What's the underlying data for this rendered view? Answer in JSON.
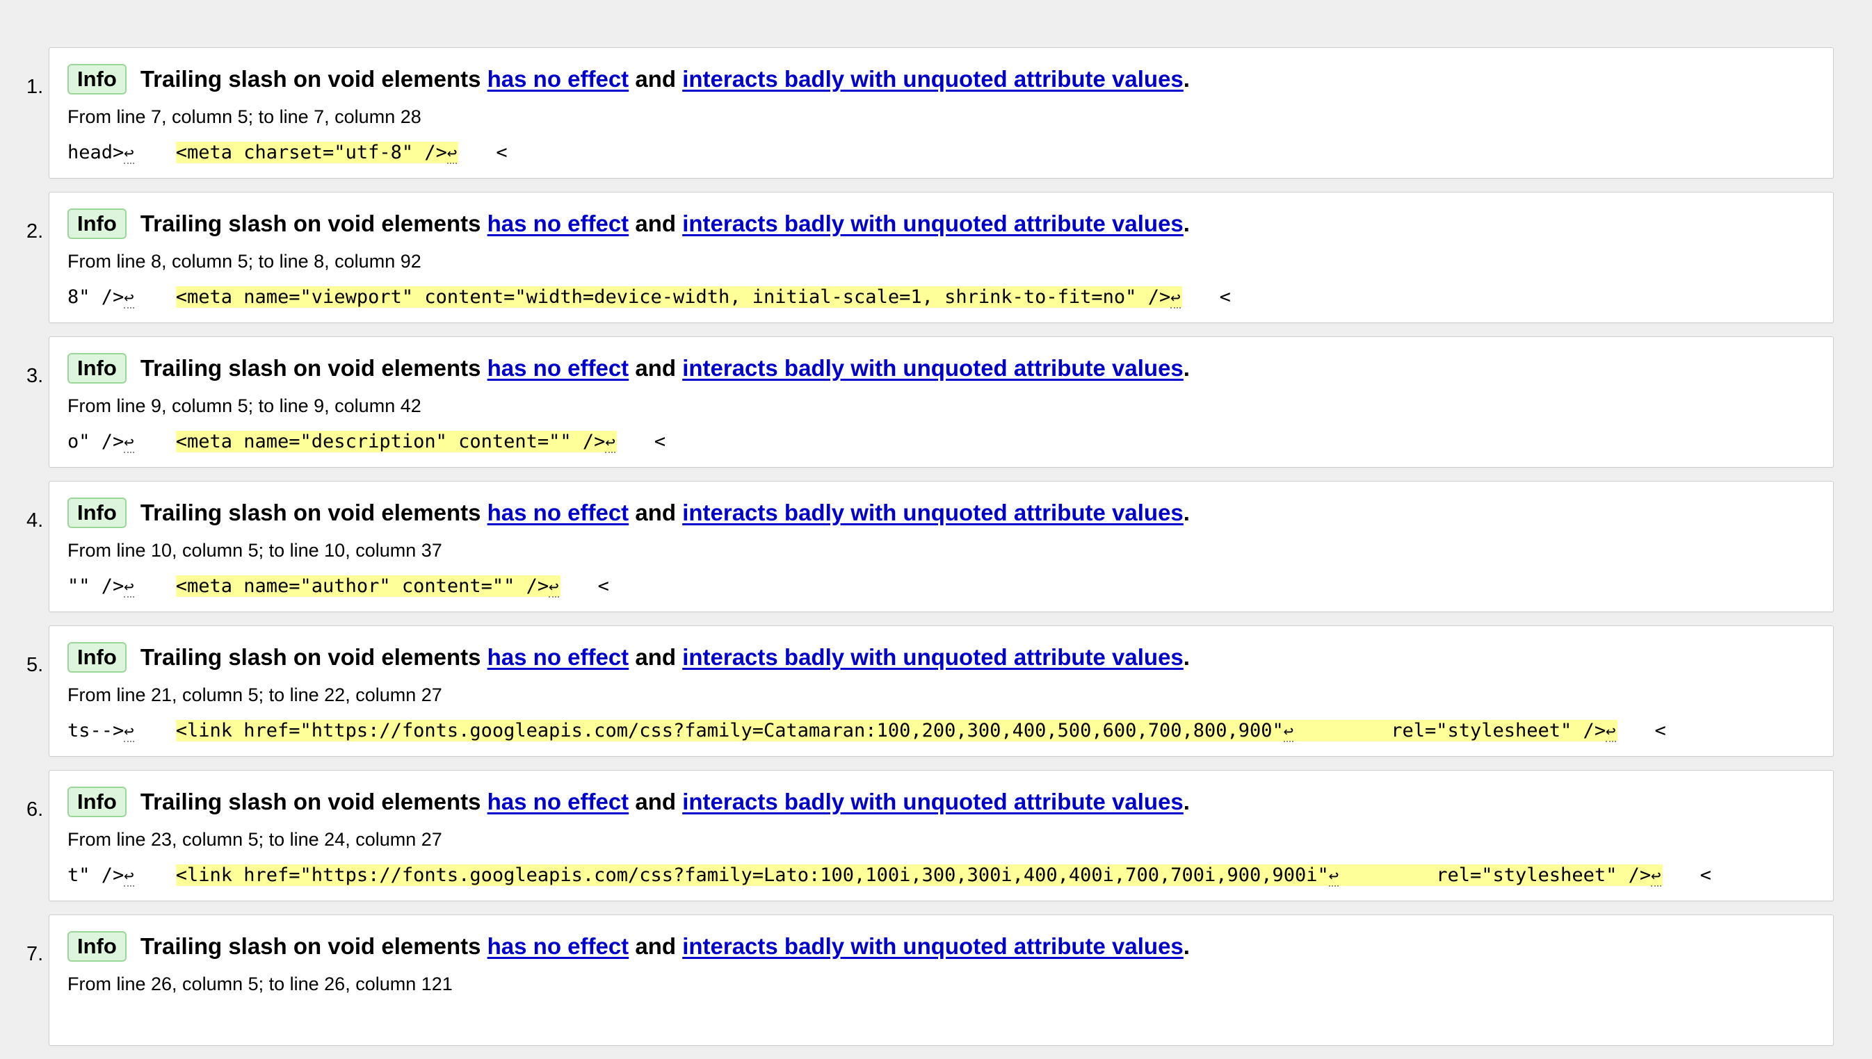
{
  "messages": [
    {
      "number": "1.",
      "type": "Info",
      "text_prefix": "Trailing slash on void elements",
      "link1": "has no effect",
      "text_mid": "and",
      "link2": "interacts badly with unquoted attribute values",
      "text_end": ".",
      "location": "From line 7, column 5; to line 7, column 28",
      "extract_before": "head>",
      "extract_highlight": "<meta charset=\"utf-8\" />",
      "extract_after": "<"
    },
    {
      "number": "2.",
      "type": "Info",
      "text_prefix": "Trailing slash on void elements",
      "link1": "has no effect",
      "text_mid": "and",
      "link2": "interacts badly with unquoted attribute values",
      "text_end": ".",
      "location": "From line 8, column 5; to line 8, column 92",
      "extract_before": "8\" />",
      "extract_highlight": "<meta name=\"viewport\" content=\"width=device-width, initial-scale=1, shrink-to-fit=no\" />",
      "extract_after": "<"
    },
    {
      "number": "3.",
      "type": "Info",
      "text_prefix": "Trailing slash on void elements",
      "link1": "has no effect",
      "text_mid": "and",
      "link2": "interacts badly with unquoted attribute values",
      "text_end": ".",
      "location": "From line 9, column 5; to line 9, column 42",
      "extract_before": "o\" />",
      "extract_highlight": "<meta name=\"description\" content=\"\" />",
      "extract_after": "<"
    },
    {
      "number": "4.",
      "type": "Info",
      "text_prefix": "Trailing slash on void elements",
      "link1": "has no effect",
      "text_mid": "and",
      "link2": "interacts badly with unquoted attribute values",
      "text_end": ".",
      "location": "From line 10, column 5; to line 10, column 37",
      "extract_before": "\"\" />",
      "extract_highlight": "<meta name=\"author\" content=\"\" />",
      "extract_after": "<"
    },
    {
      "number": "5.",
      "type": "Info",
      "text_prefix": "Trailing slash on void elements",
      "link1": "has no effect",
      "text_mid": "and",
      "link2": "interacts badly with unquoted attribute values",
      "text_end": ".",
      "location": "From line 21, column 5; to line 22, column 27",
      "extract_before": "ts-->",
      "extract_highlight": "<link href=\"https://fonts.googleapis.com/css?family=Catamaran:100,200,300,400,500,600,700,800,900\"",
      "extract_highlight2": "rel=\"stylesheet\" />",
      "extract_after": "<"
    },
    {
      "number": "6.",
      "type": "Info",
      "text_prefix": "Trailing slash on void elements",
      "link1": "has no effect",
      "text_mid": "and",
      "link2": "interacts badly with unquoted attribute values",
      "text_end": ".",
      "location": "From line 23, column 5; to line 24, column 27",
      "extract_before": "t\" />",
      "extract_highlight": "<link href=\"https://fonts.googleapis.com/css?family=Lato:100,100i,300,300i,400,400i,700,700i,900,900i\"",
      "extract_highlight2": "rel=\"stylesheet\" />",
      "extract_after": "<"
    },
    {
      "number": "7.",
      "type": "Info",
      "text_prefix": "Trailing slash on void elements",
      "link1": "has no effect",
      "text_mid": "and",
      "link2": "interacts badly with unquoted attribute values",
      "text_end": ".",
      "location": "From line 26, column 5; to line 26, column 121",
      "extract_before": "",
      "extract_highlight": "",
      "extract_after": ""
    }
  ],
  "newline_glyph": "↩"
}
